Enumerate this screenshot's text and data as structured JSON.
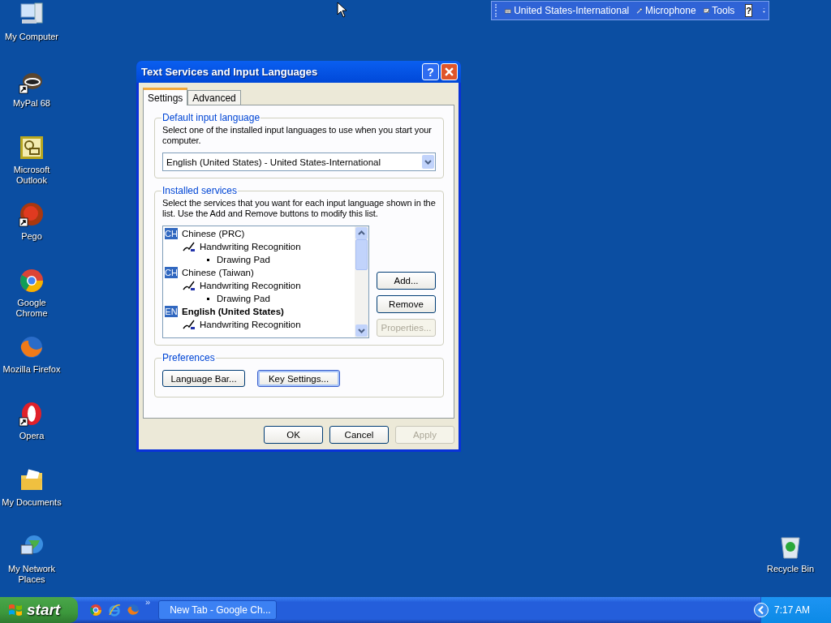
{
  "desktop_icons": [
    {
      "label": "My Computer",
      "shortcut": false
    },
    {
      "label": "MyPal 68",
      "shortcut": true
    },
    {
      "label": "Microsoft Outlook",
      "shortcut": false
    },
    {
      "label": "Pego",
      "shortcut": true
    },
    {
      "label": "Google Chrome",
      "shortcut": false
    },
    {
      "label": "Mozilla Firefox",
      "shortcut": false
    },
    {
      "label": "Opera",
      "shortcut": true
    },
    {
      "label": "My Documents",
      "shortcut": false
    },
    {
      "label": "My Network Places",
      "shortcut": false
    }
  ],
  "recycle_bin": {
    "label": "Recycle Bin"
  },
  "language_bar": {
    "keyboard": "United States-International",
    "microphone": "Microphone",
    "tools": "Tools",
    "help": "?"
  },
  "dialog": {
    "title": "Text Services and Input Languages",
    "help_button": "?",
    "tabs": [
      {
        "label": "Settings",
        "selected": true
      },
      {
        "label": "Advanced",
        "selected": false
      }
    ],
    "default_language": {
      "legend": "Default input language",
      "description": "Select one of the installed input languages to use when you start your computer.",
      "value": "English (United States) - United States-International"
    },
    "installed_services": {
      "legend": "Installed services",
      "description": "Select the services that you want for each input language shown in the list. Use the Add and Remove buttons to modify this list.",
      "languages": [
        {
          "code": "CH",
          "name": "Chinese (PRC)",
          "default": false,
          "children": [
            {
              "name": "Handwriting Recognition",
              "children": [
                {
                  "name": "Drawing Pad"
                }
              ]
            }
          ]
        },
        {
          "code": "CH",
          "name": "Chinese (Taiwan)",
          "default": false,
          "children": [
            {
              "name": "Handwriting Recognition",
              "children": [
                {
                  "name": "Drawing Pad"
                }
              ]
            }
          ]
        },
        {
          "code": "EN",
          "name": "English (United States)",
          "default": true,
          "children": [
            {
              "name": "Handwriting Recognition"
            }
          ]
        }
      ],
      "buttons": [
        {
          "label": "Add...",
          "disabled": false
        },
        {
          "label": "Remove",
          "disabled": false
        },
        {
          "label": "Properties...",
          "disabled": true
        }
      ]
    },
    "preferences": {
      "legend": "Preferences",
      "buttons": [
        {
          "label": "Language Bar...",
          "focused": false
        },
        {
          "label": "Key Settings...",
          "focused": true
        }
      ]
    },
    "buttons": [
      {
        "label": "OK",
        "disabled": false
      },
      {
        "label": "Cancel",
        "disabled": false
      },
      {
        "label": "Apply",
        "disabled": true
      }
    ]
  },
  "taskbar": {
    "start": "start",
    "quick_launch_more": "»",
    "tasks": [
      {
        "label": "New Tab - Google Ch...",
        "selected": false
      }
    ],
    "clock": "7:17 AM"
  }
}
